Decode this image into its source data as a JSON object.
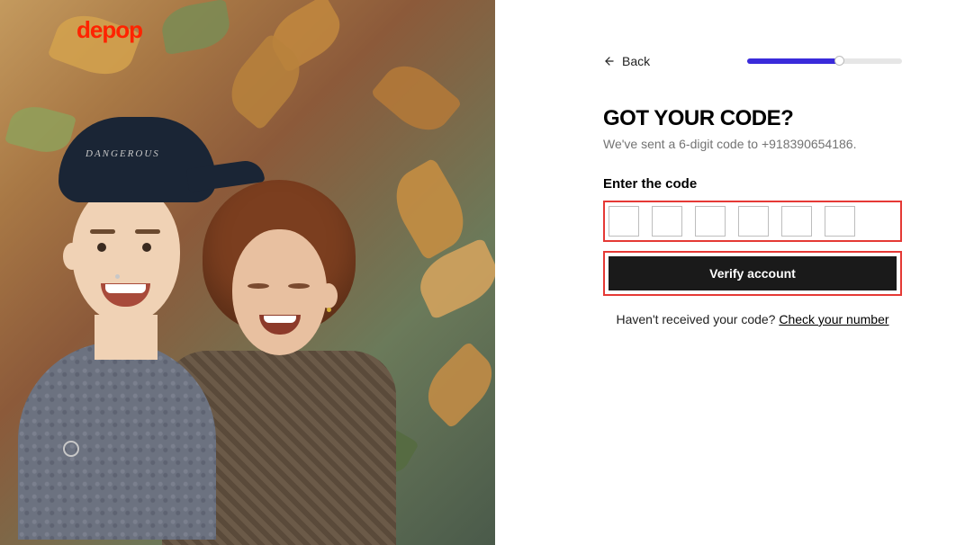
{
  "brand": {
    "logo_text": "depop"
  },
  "hero_cap_text": "DANGEROUS",
  "nav": {
    "back_label": "Back"
  },
  "progress": {
    "percent": 60
  },
  "verify": {
    "heading": "GOT YOUR CODE?",
    "subtext": "We've sent a 6-digit code to +918390654186.",
    "input_label": "Enter the code",
    "digits": [
      "",
      "",
      "",
      "",
      "",
      ""
    ],
    "button_label": "Verify account",
    "resend_prompt": "Haven't received your code? ",
    "resend_link": "Check your number"
  },
  "colors": {
    "brand_red": "#ff2300",
    "progress_blue": "#3a2bdb",
    "highlight_red": "#e53935",
    "button_bg": "#1a1a1a"
  }
}
